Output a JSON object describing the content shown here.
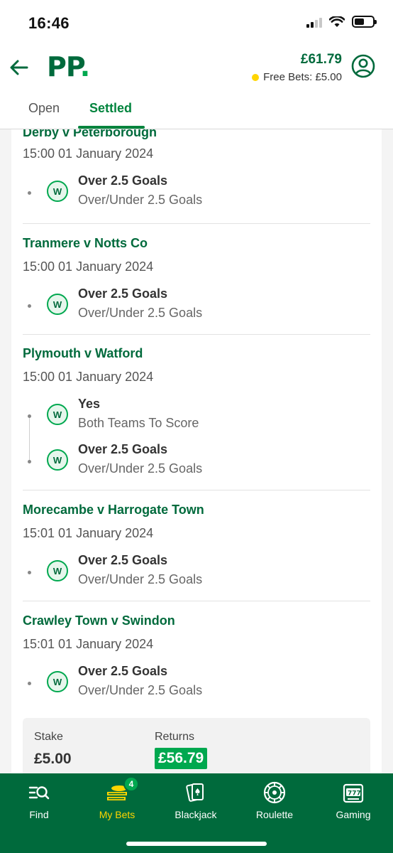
{
  "status_bar": {
    "time": "16:46"
  },
  "header": {
    "logo_text": "PP",
    "logo_dot": ".",
    "balance": "£61.79",
    "free_bets": "Free Bets: £5.00"
  },
  "tabs": [
    {
      "label": "Open",
      "active": false
    },
    {
      "label": "Settled",
      "active": true
    }
  ],
  "events": [
    {
      "title": "Derby v Peterborough",
      "time": "15:00 01 January 2024",
      "selections": [
        {
          "result": "W",
          "name": "Over 2.5 Goals",
          "market": "Over/Under 2.5 Goals"
        }
      ]
    },
    {
      "title": "Tranmere v Notts Co",
      "time": "15:00 01 January 2024",
      "selections": [
        {
          "result": "W",
          "name": "Over 2.5 Goals",
          "market": "Over/Under 2.5 Goals"
        }
      ]
    },
    {
      "title": "Plymouth v Watford",
      "time": "15:00 01 January 2024",
      "selections": [
        {
          "result": "W",
          "name": "Yes",
          "market": "Both Teams To Score"
        },
        {
          "result": "W",
          "name": "Over 2.5 Goals",
          "market": "Over/Under 2.5 Goals"
        }
      ]
    },
    {
      "title": "Morecambe v Harrogate Town",
      "time": "15:01 01 January 2024",
      "selections": [
        {
          "result": "W",
          "name": "Over 2.5 Goals",
          "market": "Over/Under 2.5 Goals"
        }
      ]
    },
    {
      "title": "Crawley Town v Swindon",
      "time": "15:01 01 January 2024",
      "selections": [
        {
          "result": "W",
          "name": "Over 2.5 Goals",
          "market": "Over/Under 2.5 Goals"
        }
      ]
    }
  ],
  "bet_summary": {
    "stake_label": "Stake",
    "stake_value": "£5.00",
    "returns_label": "Returns",
    "returns_value": "£56.79"
  },
  "bottom_nav": [
    {
      "label": "Find",
      "icon": "search-list-icon",
      "active": false
    },
    {
      "label": "My Bets",
      "icon": "coins-icon",
      "active": true,
      "badge": "4"
    },
    {
      "label": "Blackjack",
      "icon": "playing-cards-icon",
      "active": false
    },
    {
      "label": "Roulette",
      "icon": "roulette-wheel-icon",
      "active": false
    },
    {
      "label": "Gaming",
      "icon": "slot-machine-icon",
      "active": false
    }
  ],
  "colors": {
    "brand_dark": "#006a3c",
    "brand_green": "#00a84f",
    "accent_yellow": "#ffd500"
  }
}
